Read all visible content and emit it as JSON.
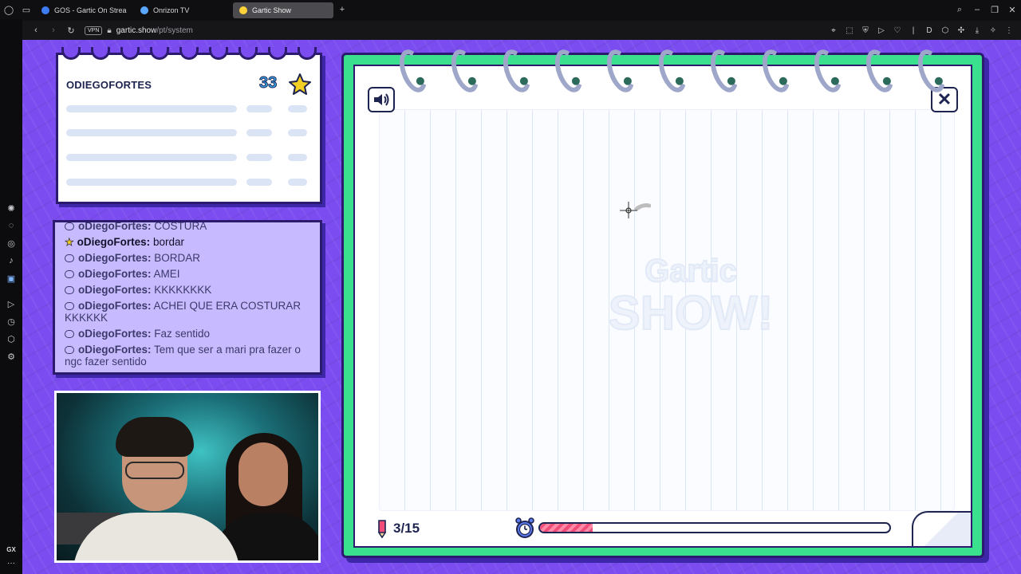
{
  "tabs": [
    {
      "label": "GOS - Gartic On Strea",
      "fav_color": "#3d7cf2"
    },
    {
      "label": "Onrizon TV",
      "fav_color": "#5aa7ff"
    },
    {
      "label": "Gartic Show",
      "fav_color": "#ffd23a"
    }
  ],
  "address": {
    "vpn": "VPN",
    "host": "gartic.show",
    "path": "/pt/system"
  },
  "sidebar": {
    "gx": "GX"
  },
  "scoreboard": {
    "player": "ODIEGOFORTES",
    "points": "33"
  },
  "chat": {
    "messages": [
      {
        "user": "oDiegoFortes:",
        "text": "COSTURA",
        "highlight": false
      },
      {
        "user": "oDiegoFortes:",
        "text": "bordar",
        "highlight": true
      },
      {
        "user": "oDiegoFortes:",
        "text": "BORDAR",
        "highlight": false
      },
      {
        "user": "oDiegoFortes:",
        "text": "AMEI",
        "highlight": false
      },
      {
        "user": "oDiegoFortes:",
        "text": "KKKKKKKK",
        "highlight": false
      },
      {
        "user": "oDiegoFortes:",
        "text": "ACHEI QUE ERA COSTURAR KKKKKK",
        "highlight": false
      },
      {
        "user": "oDiegoFortes:",
        "text": "Faz sentido",
        "highlight": false
      },
      {
        "user": "oDiegoFortes:",
        "text": "Tem que ser a mari pra fazer o ngc fazer sentido",
        "highlight": false
      }
    ]
  },
  "game": {
    "watermark_line1": "Gartic",
    "watermark_line2": "SHOW!",
    "round": "3/15",
    "timer_progress": 0.15
  },
  "colors": {
    "background": "#7b4df0",
    "notebook_border": "#3be08e",
    "timer_fill": "#f14d7a"
  }
}
